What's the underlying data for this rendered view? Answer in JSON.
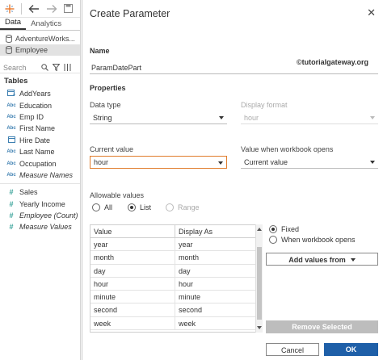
{
  "left_pane": {
    "tabs": [
      {
        "label": "Data",
        "active": true
      },
      {
        "label": "Analytics",
        "active": false
      }
    ],
    "datasources": [
      "AdventureWorks...",
      "Employee"
    ],
    "search_placeholder": "Search",
    "tables_heading": "Tables",
    "dimensions": [
      {
        "icon": "calc-icon",
        "label": "AddYears"
      },
      {
        "icon": "Abc",
        "label": "Education"
      },
      {
        "icon": "Abc",
        "label": "Emp ID"
      },
      {
        "icon": "Abc",
        "label": "First Name"
      },
      {
        "icon": "calendar-icon",
        "label": "Hire Date"
      },
      {
        "icon": "Abc",
        "label": "Last Name"
      },
      {
        "icon": "Abc",
        "label": "Occupation"
      },
      {
        "icon": "Abc",
        "label": "Measure Names"
      }
    ],
    "measures": [
      {
        "icon": "#",
        "label": "Sales"
      },
      {
        "icon": "#",
        "label": "Yearly Income"
      },
      {
        "icon": "#",
        "label": "Employee (Count)"
      },
      {
        "icon": "#",
        "label": "Measure Values"
      }
    ]
  },
  "dialog": {
    "title": "Create Parameter",
    "name_label": "Name",
    "name_value": "ParamDatePart",
    "watermark": "©tutorialgateway.org",
    "properties_label": "Properties",
    "data_type_label": "Data type",
    "data_type_value": "String",
    "display_format_label": "Display format",
    "display_format_value": "hour",
    "current_value_label": "Current value",
    "current_value_value": "hour",
    "when_opens_label": "Value when workbook opens",
    "when_opens_value": "Current value",
    "allowable_label": "Allowable values",
    "allowable_options": [
      "All",
      "List",
      "Range"
    ],
    "allowable_selected": "List",
    "table_headers": [
      "Value",
      "Display As"
    ],
    "table_rows": [
      [
        "year",
        "year"
      ],
      [
        "month",
        "month"
      ],
      [
        "day",
        "day"
      ],
      [
        "hour",
        "hour"
      ],
      [
        "minute",
        "minute"
      ],
      [
        "second",
        "second"
      ],
      [
        "week",
        "week"
      ]
    ],
    "list_options": [
      "Fixed",
      "When workbook opens"
    ],
    "list_selected": "Fixed",
    "add_values_label": "Add values from",
    "remove_selected_label": "Remove Selected",
    "cancel_label": "Cancel",
    "ok_label": "OK"
  },
  "colors": {
    "ok_button": "#1e5fa8",
    "current_value_highlight": "#e07b2a",
    "dimension_icon": "#3d7fb1",
    "measure_icon": "#3aa39a"
  }
}
